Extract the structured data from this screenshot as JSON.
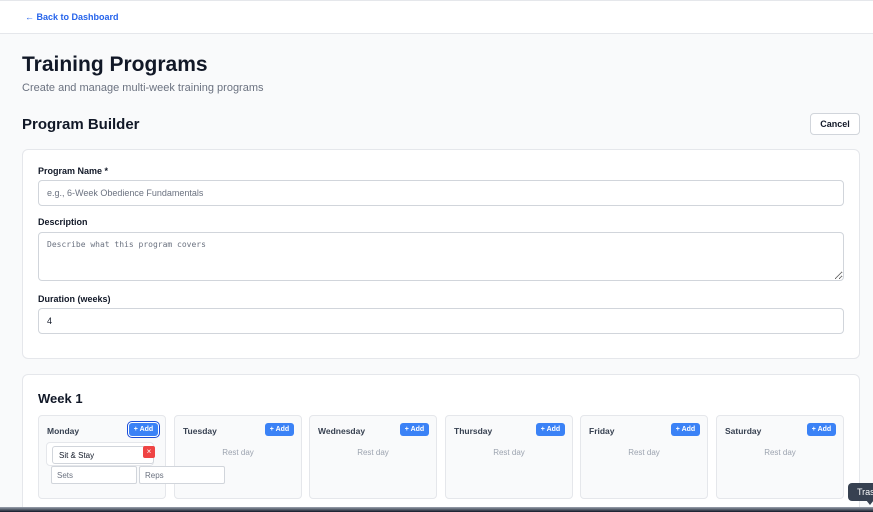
{
  "nav": {
    "back_label": "← Back to Dashboard"
  },
  "header": {
    "title": "Training Programs",
    "subtitle": "Create and manage multi-week training programs"
  },
  "builder": {
    "title": "Program Builder",
    "cancel_label": "Cancel"
  },
  "form": {
    "name_label": "Program Name *",
    "name_placeholder": "e.g., 6-Week Obedience Fundamentals",
    "description_label": "Description",
    "description_placeholder": "Describe what this program covers",
    "duration_label": "Duration (weeks)",
    "duration_value": "4"
  },
  "week": {
    "title": "Week 1",
    "add_label": "+ Add",
    "rest_label": "Rest day",
    "days": [
      {
        "name": "Monday"
      },
      {
        "name": "Tuesday"
      },
      {
        "name": "Wednesday"
      },
      {
        "name": "Thursday"
      },
      {
        "name": "Friday"
      },
      {
        "name": "Saturday"
      }
    ],
    "exercise": {
      "name_value": "Sit & Stay",
      "remove_label": "×",
      "sets_placeholder": "Sets",
      "reps_placeholder": "Reps"
    }
  },
  "tooltip": {
    "text": "Trash"
  },
  "colors": {
    "accent": "#3b82f6",
    "link": "#2563eb",
    "danger": "#ef4444"
  }
}
